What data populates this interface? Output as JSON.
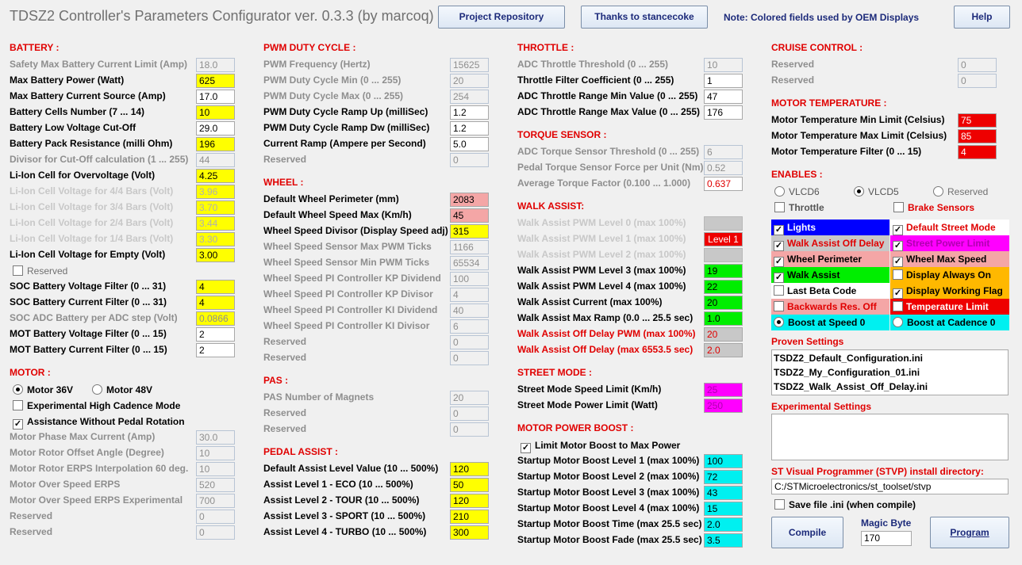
{
  "app": {
    "title": "TDSZ2 Controller's Parameters Configurator ver. 0.3.3 (by marcoq)",
    "btn_repository": "Project Repository",
    "btn_thanks": "Thanks to stancecoke",
    "note": "Note: Colored fields used by OEM Displays",
    "btn_help": "Help"
  },
  "battery": {
    "title": "BATTERY :",
    "rows": [
      {
        "label": "Safety Max Battery Current Limit (Amp)",
        "value": "18.0"
      },
      {
        "label": "Max Battery Power (Watt)",
        "value": "625"
      },
      {
        "label": "Max Battery Current Source (Amp)",
        "value": "17.0"
      },
      {
        "label": "Battery Cells Number (7 ... 14)",
        "value": "10"
      },
      {
        "label": "Battery Low Voltage Cut-Off",
        "value": "29.0"
      },
      {
        "label": "Battery Pack Resistance (milli Ohm)",
        "value": "196"
      },
      {
        "label": "Divisor for Cut-Off calculation (1 ... 255)",
        "value": "44"
      },
      {
        "label": "Li-Ion Cell for Overvoltage (Volt)",
        "value": "4.25"
      },
      {
        "label": "Li-Ion Cell Voltage for 4/4 Bars (Volt)",
        "value": "3.96"
      },
      {
        "label": "Li-Ion Cell Voltage for 3/4 Bars (Volt)",
        "value": "3.70"
      },
      {
        "label": "Li-Ion Cell Voltage for 2/4 Bars (Volt)",
        "value": "3.44"
      },
      {
        "label": "Li-Ion Cell Voltage for 1/4 Bars (Volt)",
        "value": "3.30"
      },
      {
        "label": "Li-Ion Cell Voltage for Empty (Volt)",
        "value": "3.00"
      }
    ],
    "reserved_check": "Reserved",
    "rows2": [
      {
        "label": "SOC Battery Voltage Filter (0 ... 31)",
        "value": "4"
      },
      {
        "label": "SOC Battery Current Filter (0 ... 31)",
        "value": "4"
      },
      {
        "label": "SOC ADC Battery per ADC step (Volt)",
        "value": "0.0866"
      },
      {
        "label": "MOT Battery Voltage Filter (0 ... 15)",
        "value": "2"
      },
      {
        "label": "MOT Battery Current Filter (0 ... 15)",
        "value": "2"
      }
    ]
  },
  "motor": {
    "title": "MOTOR :",
    "radio_36": "Motor 36V",
    "radio_48": "Motor 48V",
    "check_cadence": "Experimental High Cadence Mode",
    "check_assist": "Assistance Without Pedal Rotation",
    "rows": [
      {
        "label": "Motor Phase Max Current (Amp)",
        "value": "30.0"
      },
      {
        "label": "Motor Rotor Offset Angle (Degree)",
        "value": "10"
      },
      {
        "label": "Motor Rotor ERPS Interpolation 60 deg.",
        "value": "10"
      },
      {
        "label": "Motor Over Speed ERPS",
        "value": "520"
      },
      {
        "label": "Motor Over Speed ERPS Experimental",
        "value": "700"
      },
      {
        "label": "Reserved",
        "value": "0"
      },
      {
        "label": "Reserved",
        "value": "0"
      }
    ]
  },
  "pwm": {
    "title": "PWM DUTY CYCLE :",
    "rows": [
      {
        "label": "PWM Frequency (Hertz)",
        "value": "15625"
      },
      {
        "label": "PWM Duty Cycle Min (0 ... 255)",
        "value": "20"
      },
      {
        "label": "PWM Duty Cycle Max (0 ... 255)",
        "value": "254"
      },
      {
        "label": "PWM Duty Cycle Ramp Up (milliSec)",
        "value": "1.2"
      },
      {
        "label": "PWM Duty Cycle Ramp Dw (milliSec)",
        "value": "1.2"
      },
      {
        "label": "Current Ramp (Ampere per Second)",
        "value": "5.0"
      },
      {
        "label": "Reserved",
        "value": "0"
      }
    ]
  },
  "wheel": {
    "title": "WHEEL :",
    "rows": [
      {
        "label": "Default Wheel Perimeter (mm)",
        "value": "2083"
      },
      {
        "label": "Default Wheel Speed Max (Km/h)",
        "value": "45"
      },
      {
        "label": "Wheel Speed Divisor (Display Speed adj)",
        "value": "315"
      },
      {
        "label": "Wheel Speed Sensor Max PWM Ticks",
        "value": "1166"
      },
      {
        "label": "Wheel Speed Sensor Min PWM Ticks",
        "value": "65534"
      },
      {
        "label": "Wheel Speed PI Controller KP Dividend",
        "value": "100"
      },
      {
        "label": "Wheel Speed PI Controller KP Divisor",
        "value": "4"
      },
      {
        "label": "Wheel Speed PI Controller KI Dividend",
        "value": "40"
      },
      {
        "label": "Wheel Speed PI Controller KI Divisor",
        "value": "6"
      },
      {
        "label": "Reserved",
        "value": "0"
      },
      {
        "label": "Reserved",
        "value": "0"
      }
    ]
  },
  "pas": {
    "title": "PAS :",
    "rows": [
      {
        "label": "PAS Number of Magnets",
        "value": "20"
      },
      {
        "label": "Reserved",
        "value": "0"
      },
      {
        "label": "Reserved",
        "value": "0"
      }
    ]
  },
  "pedal": {
    "title": "PEDAL ASSIST :",
    "rows": [
      {
        "label": "Default Assist Level Value (10 ... 500%)",
        "value": "120"
      },
      {
        "label": "Assist Level 1 - ECO (10 ... 500%)",
        "value": "50"
      },
      {
        "label": "Assist Level 2 - TOUR (10 ... 500%)",
        "value": "120"
      },
      {
        "label": "Assist Level 3 - SPORT (10 ... 500%)",
        "value": "210"
      },
      {
        "label": "Assist Level 4 - TURBO (10 ... 500%)",
        "value": "300"
      }
    ]
  },
  "throttle": {
    "title": "THROTTLE :",
    "rows": [
      {
        "label": "ADC Throttle Threshold (0 ... 255)",
        "value": "10"
      },
      {
        "label": "Throttle Filter Coefficient (0 ... 255)",
        "value": "1"
      },
      {
        "label": "ADC Throttle Range Min Value (0 ... 255)",
        "value": "47"
      },
      {
        "label": "ADC Throttle Range Max Value (0 ... 255)",
        "value": "176"
      }
    ]
  },
  "torque": {
    "title": "TORQUE SENSOR :",
    "rows": [
      {
        "label": "ADC Torque Sensor Threshold (0 ... 255)",
        "value": "6"
      },
      {
        "label": "Pedal Torque Sensor Force per Unit (Nm)",
        "value": "0.52"
      },
      {
        "label": "Average Torque Factor (0.100 ... 1.000)",
        "value": "0.637"
      }
    ]
  },
  "walk": {
    "title": "WALK ASSIST:",
    "rows": [
      {
        "label": "Walk Assist PWM Level 0 (max 100%)",
        "value": ""
      },
      {
        "label": "Walk Assist PWM Level 1 (max 100%)",
        "value": "Level 1"
      },
      {
        "label": "Walk Assist PWM Level 2 (max 100%)",
        "value": ""
      },
      {
        "label": "Walk Assist PWM Level 3 (max 100%)",
        "value": "19"
      },
      {
        "label": "Walk Assist PWM Level 4 (max 100%)",
        "value": "22"
      },
      {
        "label": "Walk Assist Current (max 100%)",
        "value": "20"
      },
      {
        "label": "Walk Assist Max Ramp (0.0 ... 25.5 sec)",
        "value": "1.0"
      },
      {
        "label": "Walk Assist Off Delay PWM (max 100%)",
        "value": "20"
      },
      {
        "label": "Walk Assist Off Delay (max 6553.5 sec)",
        "value": "2.0"
      }
    ]
  },
  "street": {
    "title": "STREET MODE :",
    "rows": [
      {
        "label": "Street Mode Speed Limit (Km/h)",
        "value": "25"
      },
      {
        "label": "Street Mode Power Limit (Watt)",
        "value": "250"
      }
    ]
  },
  "boost": {
    "title": "MOTOR POWER BOOST :",
    "check_limit": "Limit Motor Boost to Max Power",
    "rows": [
      {
        "label": "Startup Motor Boost Level 1 (max 100%)",
        "value": "100"
      },
      {
        "label": "Startup Motor Boost Level 2 (max 100%)",
        "value": "72"
      },
      {
        "label": "Startup Motor Boost Level 3 (max 100%)",
        "value": "43"
      },
      {
        "label": "Startup Motor Boost Level 4 (max 100%)",
        "value": "15"
      },
      {
        "label": "Startup Motor Boost Time (max 25.5 sec)",
        "value": "2.0"
      },
      {
        "label": "Startup Motor Boost Fade (max 25.5 sec)",
        "value": "3.5"
      }
    ]
  },
  "cruise": {
    "title": "CRUISE CONTROL :",
    "rows": [
      {
        "label": "Reserved",
        "value": "0"
      },
      {
        "label": "Reserved",
        "value": "0"
      }
    ]
  },
  "temp": {
    "title": "MOTOR TEMPERATURE :",
    "rows": [
      {
        "label": "Motor Temperature Min Limit (Celsius)",
        "value": "75"
      },
      {
        "label": "Motor Temperature Max Limit (Celsius)",
        "value": "85"
      },
      {
        "label": "Motor Temperature Filter (0 ... 15)",
        "value": "4"
      }
    ]
  },
  "enables": {
    "title": "ENABLES :",
    "radio_vlcd6": "VLCD6",
    "radio_vlcd5": "VLCD5",
    "radio_reserved": "Reserved",
    "check_throttle": "Throttle",
    "check_brake": "Brake Sensors",
    "lights": "Lights",
    "default_street": "Default Street Mode",
    "walk_off_delay": "Walk Assist Off Delay",
    "street_power": "Street Power Limit",
    "wheel_perimeter": "Wheel Perimeter",
    "wheel_max_speed": "Wheel Max Speed",
    "walk_assist": "Walk Assist",
    "display_always": "Display Always On",
    "last_beta": "Last Beta Code",
    "display_working": "Display Working Flag",
    "backwards": "Backwards Res. Off",
    "temperature_limit": "Temperature Limit",
    "boost_speed": "Boost at Speed 0",
    "boost_cadence": "Boost at Cadence 0"
  },
  "proven": {
    "title": "Proven Settings",
    "items": [
      "TSDZ2_Default_Configuration.ini",
      "TSDZ2_My_Configuration_01.ini",
      "TSDZ2_Walk_Assist_Off_Delay.ini"
    ]
  },
  "experimental": {
    "title": "Experimental Settings"
  },
  "stvp": {
    "title": "ST Visual Programmer (STVP) install directory:",
    "path": "C:/STMicroelectronics/st_toolset/stvp",
    "check_save": "Save file .ini (when compile)"
  },
  "actions": {
    "compile": "Compile",
    "magic_label": "Magic Byte",
    "magic_value": "170",
    "program": "Program"
  },
  "colors": {
    "section_red": "#e00000",
    "yellow": "#ffff00",
    "pink": "#f4a6a6",
    "green": "#00ee00",
    "cyan": "#00f0f0",
    "magenta": "#ff00ff",
    "red": "#ee0000",
    "blue": "#0000ff",
    "orange": "#ffb800",
    "button_text": "#1c2a7a"
  }
}
